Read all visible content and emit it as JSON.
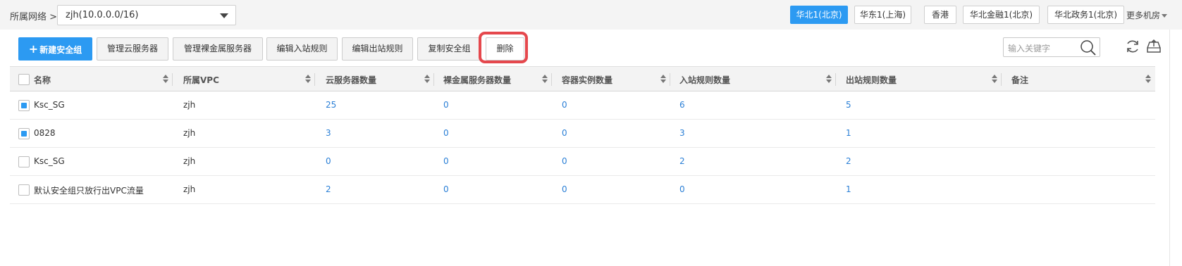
{
  "network": {
    "label": "所属网络 >",
    "selected": "zjh(10.0.0.0/16)"
  },
  "regions": [
    {
      "label": "华北1(北京)",
      "active": true
    },
    {
      "label": "华东1(上海)",
      "active": false
    },
    {
      "label": "香港",
      "active": false
    },
    {
      "label": "华北金融1(北京)",
      "active": false
    },
    {
      "label": "华北政务1(北京)",
      "active": false
    }
  ],
  "more_rooms": "更多机房",
  "toolbar": {
    "new_group": "新建安全组",
    "manage_cloud": "管理云服务器",
    "manage_baremetal": "管理裸金属服务器",
    "edit_inbound": "编辑入站规则",
    "edit_outbound": "编辑出站规则",
    "copy_group": "复制安全组",
    "delete": "删除"
  },
  "search": {
    "placeholder": "输入关键字"
  },
  "table": {
    "columns": [
      "名称",
      "所属VPC",
      "云服务器数量",
      "裸金属服务器数量",
      "容器实例数量",
      "入站规则数量",
      "出站规则数量",
      "备注"
    ],
    "rows": [
      {
        "checked": true,
        "name": "Ksc_SG",
        "vpc": "zjh",
        "cloud": "25",
        "baremetal": "0",
        "container": "0",
        "inbound": "6",
        "outbound": "5",
        "note": ""
      },
      {
        "checked": true,
        "name": "0828",
        "vpc": "zjh",
        "cloud": "3",
        "baremetal": "0",
        "container": "0",
        "inbound": "3",
        "outbound": "1",
        "note": ""
      },
      {
        "checked": false,
        "name": "Ksc_SG",
        "vpc": "zjh",
        "cloud": "0",
        "baremetal": "0",
        "container": "0",
        "inbound": "2",
        "outbound": "2",
        "note": ""
      },
      {
        "checked": false,
        "name": "默认安全组只放行出VPC流量",
        "vpc": "zjh",
        "cloud": "2",
        "baremetal": "0",
        "container": "0",
        "inbound": "0",
        "outbound": "1",
        "note": ""
      }
    ]
  },
  "colors": {
    "accent": "#2c9af2",
    "link": "#2a7fd6",
    "highlight": "#e5484d"
  }
}
